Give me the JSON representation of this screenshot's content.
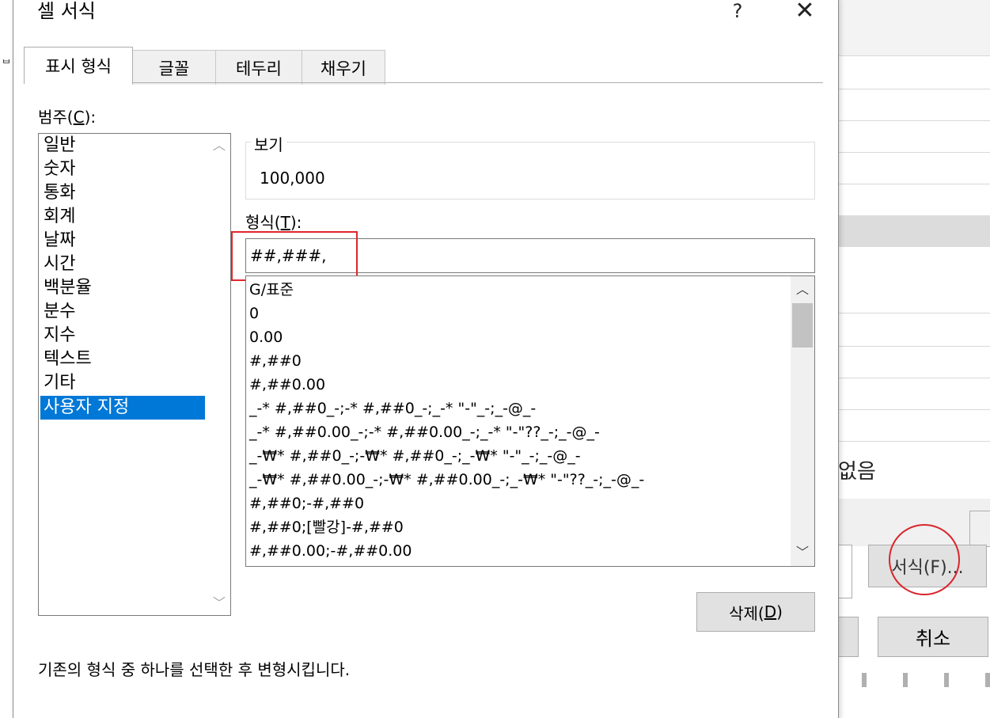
{
  "dialog": {
    "title": "셀 서식",
    "help_glyph": "?",
    "close_glyph": "✕"
  },
  "tabs": [
    "표시 형식",
    "글꼴",
    "테두리",
    "채우기"
  ],
  "category": {
    "label_prefix": "범주(",
    "label_key": "C",
    "label_suffix": "):",
    "items": [
      "일반",
      "숫자",
      "통화",
      "회계",
      "날짜",
      "시간",
      "백분율",
      "분수",
      "지수",
      "텍스트",
      "기타",
      "사용자 지정"
    ],
    "selected_index": 11
  },
  "preview": {
    "label": "보기",
    "value": "100,000"
  },
  "format": {
    "label_prefix": "형식(",
    "label_key": "T",
    "label_suffix": "):",
    "input_value": "##,###,",
    "options": [
      "G/표준",
      "0",
      "0.00",
      "#,##0",
      "#,##0.00",
      "_-* #,##0_-;-* #,##0_-;_-* \"-\"_-;_-@_-",
      "_-* #,##0.00_-;-* #,##0.00_-;_-* \"-\"??_-;_-@_-",
      "_-₩* #,##0_-;-₩* #,##0_-;_-₩* \"-\"_-;_-@_-",
      "_-₩* #,##0.00_-;-₩* #,##0.00_-;_-₩* \"-\"??_-;_-@_-",
      "#,##0;-#,##0",
      "#,##0;[빨강]-#,##0",
      "#,##0.00;-#,##0.00"
    ]
  },
  "delete_button": {
    "label_prefix": "삭제(",
    "label_key": "D",
    "label_suffix": ")"
  },
  "description": "기존의 형식 중 하나를 선택한 후 변형시킵니다.",
  "background": {
    "no_text": "없음",
    "partial_button": "서식(F)...",
    "cancel_label": "취소"
  },
  "icons": {
    "scroll_up": "chevron-up-icon",
    "scroll_down": "chevron-down-icon"
  },
  "colors": {
    "selection": "#0078d7",
    "highlight": "#e0262e"
  }
}
